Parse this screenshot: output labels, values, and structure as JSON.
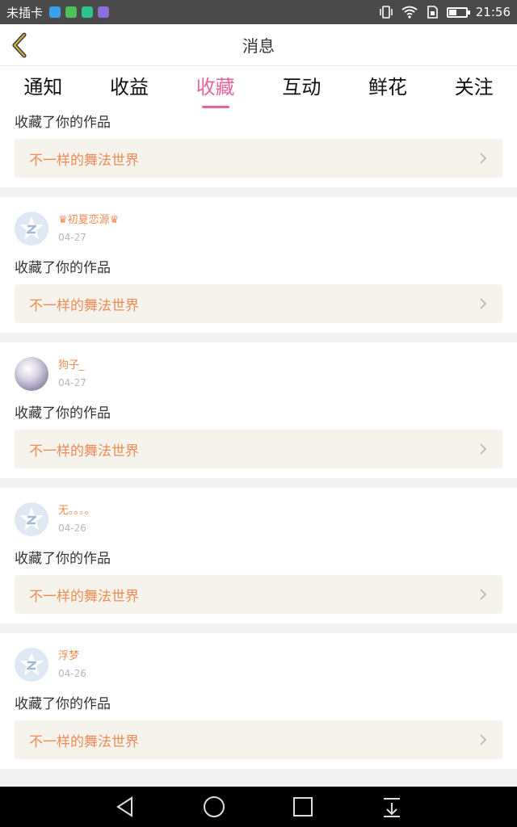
{
  "status_bar": {
    "carrier": "未插卡",
    "time": "21:56",
    "app_colors": [
      "#3aa0e8",
      "#4cc15a",
      "#2ec28a",
      "#8b6fd6"
    ]
  },
  "header": {
    "title": "消息"
  },
  "tabs": [
    {
      "label": "通知"
    },
    {
      "label": "收益"
    },
    {
      "label": "收藏"
    },
    {
      "label": "互动"
    },
    {
      "label": "鲜花"
    },
    {
      "label": "关注"
    }
  ],
  "active_tab": "收藏",
  "items": [
    {
      "action": "收藏了你的作品",
      "work_title": "不一样的舞法世界"
    },
    {
      "username": "♛初夏恋源♛",
      "date": "04-27",
      "action": "收藏了你的作品",
      "work_title": "不一样的舞法世界"
    },
    {
      "username": "狗子_",
      "date": "04-27",
      "action": "收藏了你的作品",
      "work_title": "不一样的舞法世界"
    },
    {
      "username": "无。。。。",
      "date": "04-26",
      "action": "收藏了你的作品",
      "work_title": "不一样的舞法世界"
    },
    {
      "username": "浮梦",
      "date": "04-26",
      "action": "收藏了你的作品",
      "work_title": "不一样的舞法世界"
    }
  ],
  "colors": {
    "accent": "#e8639a",
    "username": "#f08b54",
    "work_box_bg": "#f5f3ec"
  }
}
